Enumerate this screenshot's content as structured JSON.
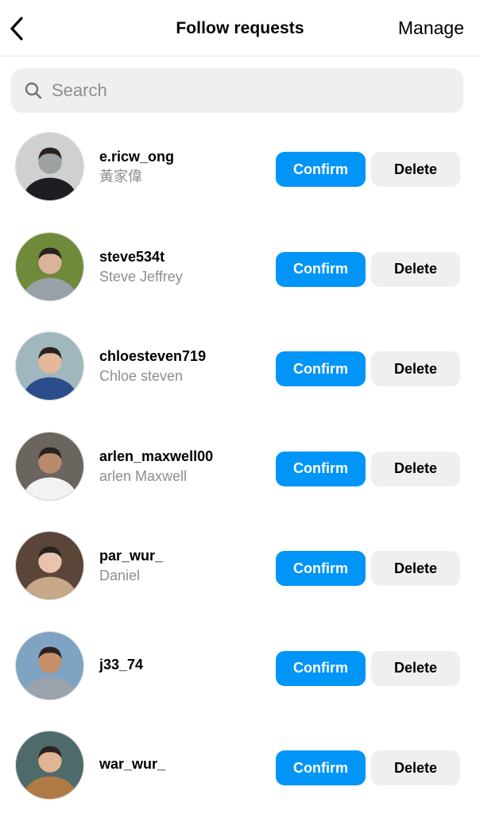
{
  "header": {
    "title": "Follow requests",
    "back_icon": "chevron-left-icon",
    "manage_label": "Manage"
  },
  "search": {
    "placeholder": "Search",
    "value": "",
    "icon": "search-icon"
  },
  "colors": {
    "primary": "#0095f6",
    "secondary_button": "#efefef",
    "muted_text": "#8e8e8e",
    "search_bg": "#efefef"
  },
  "requests": [
    {
      "username": "e.ricw_ong",
      "full_name": "黃家偉",
      "confirm_label": "Confirm",
      "delete_label": "Delete",
      "avatar": {
        "bg": "#cfd0d0",
        "fg": "#1e1e22",
        "accent": "#9ea1a3"
      }
    },
    {
      "username": "steve534t",
      "full_name": "Steve Jeffrey",
      "confirm_label": "Confirm",
      "delete_label": "Delete",
      "avatar": {
        "bg": "#6f8a3a",
        "fg": "#9aa0a8",
        "accent": "#d9b49a"
      }
    },
    {
      "username": "chloesteven719",
      "full_name": "Chloe steven",
      "confirm_label": "Confirm",
      "delete_label": "Delete",
      "avatar": {
        "bg": "#9fb7bd",
        "fg": "#2b4d8c",
        "accent": "#e3b99a"
      }
    },
    {
      "username": "arlen_maxwell00",
      "full_name": "arlen Maxwell",
      "confirm_label": "Confirm",
      "delete_label": "Delete",
      "avatar": {
        "bg": "#6b6560",
        "fg": "#f2f2f2",
        "accent": "#b98a6c"
      }
    },
    {
      "username": "par_wur_",
      "full_name": "Daniel",
      "confirm_label": "Confirm",
      "delete_label": "Delete",
      "avatar": {
        "bg": "#5b4538",
        "fg": "#c7a98a",
        "accent": "#e8c4ae"
      }
    },
    {
      "username": "j33_74",
      "full_name": "",
      "confirm_label": "Confirm",
      "delete_label": "Delete",
      "avatar": {
        "bg": "#7fa3c2",
        "fg": "#9aa3ab",
        "accent": "#c78f6a"
      }
    },
    {
      "username": "war_wur_",
      "full_name": "",
      "confirm_label": "Confirm",
      "delete_label": "Delete",
      "avatar": {
        "bg": "#4f6a6a",
        "fg": "#b07a45",
        "accent": "#e0b494"
      }
    }
  ]
}
